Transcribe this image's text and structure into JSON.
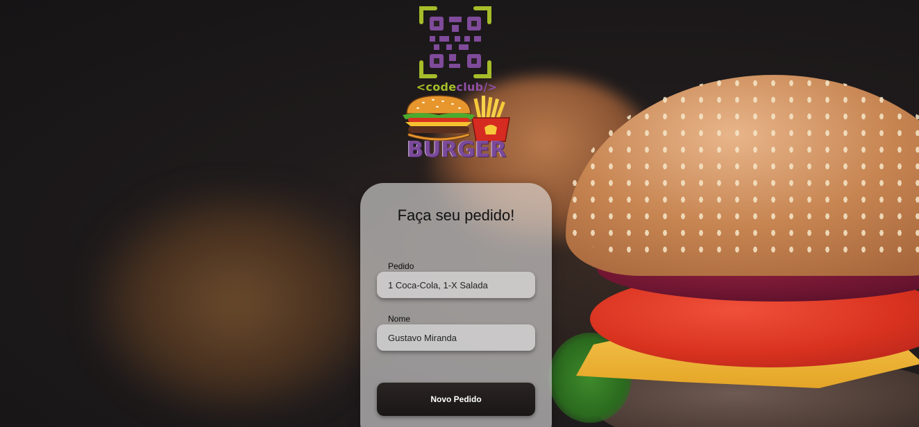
{
  "logo": {
    "code_prefix": "<code",
    "club_suffix": "club/>",
    "brand_word": "BURGER"
  },
  "form": {
    "title": "Faça seu pedido!",
    "order_label": "Pedido",
    "order_value": "1 Coca-Cola, 1-X Salada",
    "name_label": "Nome",
    "name_value": "Gustavo Miranda",
    "submit_label": "Novo Pedido"
  },
  "colors": {
    "qr_frame": "#a6bd2a",
    "qr_pixels": "#7f4b9a",
    "button_bg": "#1f1a19"
  }
}
